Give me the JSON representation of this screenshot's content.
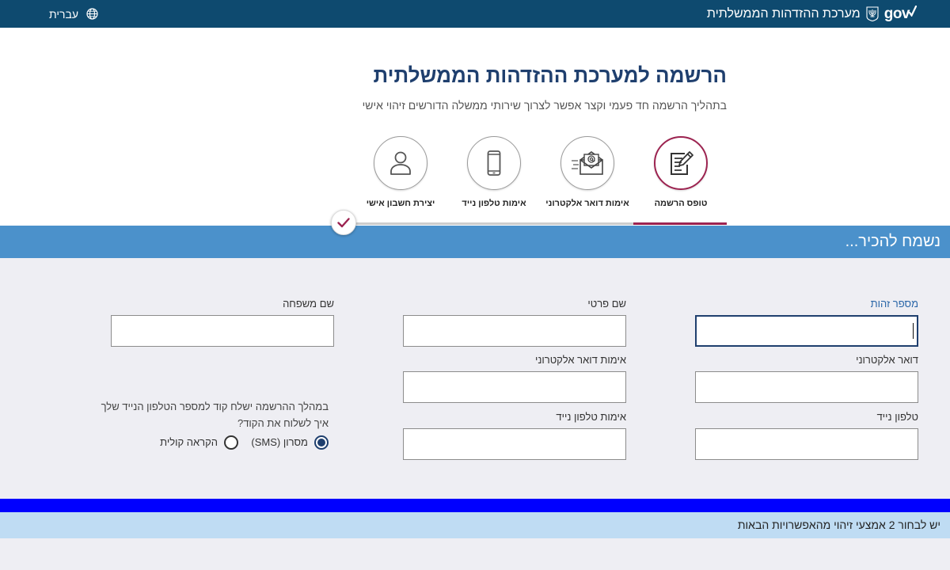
{
  "header": {
    "logo_text": "gov",
    "system_name": "מערכת ההזדהות הממשלתית",
    "language_label": "עברית",
    "emblem_icon": "state-emblem-icon",
    "language_icon": "globe-icon"
  },
  "intro": {
    "title": "הרשמה למערכת ההזדהות הממשלתית",
    "subtitle": "בתהליך הרשמה חד פעמי וקצר אפשר לצרוך שירותי ממשלה הדורשים זיהוי אישי"
  },
  "wizard": {
    "current_step": 1,
    "steps": [
      {
        "label": "טופס הרשמה",
        "icon": "form-edit-icon",
        "active": true
      },
      {
        "label": "אימות דואר אלקטרוני",
        "icon": "email-verify-icon",
        "active": false
      },
      {
        "label": "אימות טלפון נייד",
        "icon": "mobile-phone-icon",
        "active": false
      },
      {
        "label": "יצירת חשבון אישי",
        "icon": "user-account-icon",
        "active": false
      }
    ],
    "end_icon": "checkmark-icon"
  },
  "section_title": "נשמח להכיר...",
  "form": {
    "id_number": {
      "label": "מספר זהות",
      "value": "",
      "focused": true
    },
    "first_name": {
      "label": "שם פרטי",
      "value": ""
    },
    "last_name": {
      "label": "שם משפחה",
      "value": ""
    },
    "email": {
      "label": "דואר אלקטרוני",
      "value": ""
    },
    "email_confirm": {
      "label": "אימות דואר אלקטרוני",
      "value": ""
    },
    "mobile": {
      "label": "טלפון נייד",
      "value": ""
    },
    "mobile_confirm": {
      "label": "אימות טלפון נייד",
      "value": ""
    },
    "code_delivery": {
      "note": "במהלך ההרשמה ישלח קוד למספר הטלפון הנייד שלך",
      "question": "איך לשלוח את הקוד?",
      "options": [
        {
          "label": "מסרון (SMS)",
          "selected": true
        },
        {
          "label": "הקראה קולית",
          "selected": false
        }
      ]
    }
  },
  "info_banner": "יש לבחור 2 אמצעי זיהוי מהאפשרויות הבאות",
  "colors": {
    "header_bg": "#0e4a6f",
    "accent": "#9c2350",
    "section_banner_bg": "#4b91cb",
    "title_text": "#1f3f6e",
    "focus_bar": "#0000ff",
    "info_banner_bg": "#bfdcf3",
    "form_bg": "#eeeef3",
    "active_label": "#2a66a8"
  }
}
